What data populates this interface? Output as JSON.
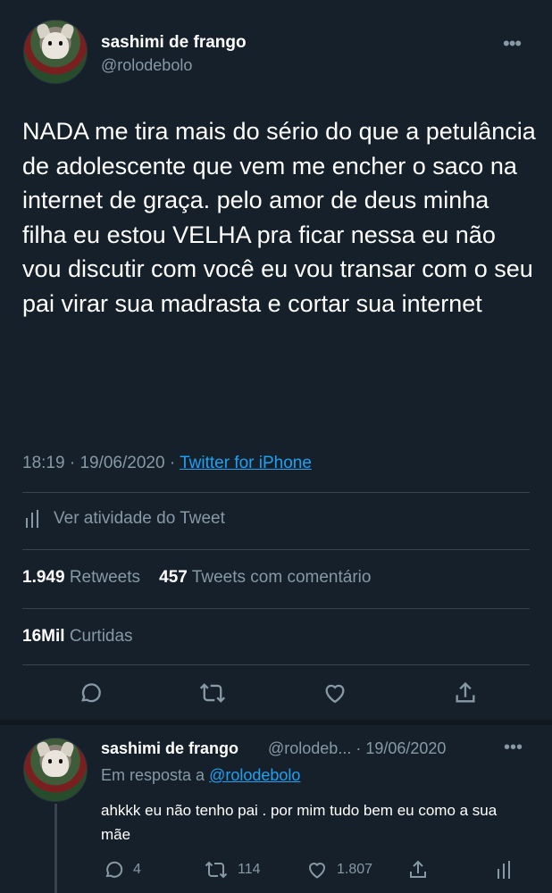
{
  "main_tweet": {
    "display_name": "sashimi de frango",
    "handle": "@rolodebolo",
    "more": "•••",
    "text": "NADA me tira mais do sério do que a petulância de adolescente que vem me encher o saco na internet de graça. pelo amor de deus minha filha eu estou VELHA pra ficar nessa eu não vou discutir com você eu vou transar com o seu pai virar sua madrasta e cortar sua internet",
    "time": "18:19",
    "date": "19/06/2020",
    "separator": "·",
    "source": "Twitter for iPhone",
    "activity_label": "Ver atividade do Tweet",
    "retweets_count": "1.949",
    "retweets_label": "Retweets",
    "comments_count": "457",
    "comments_label": "Tweets com comentário",
    "likes_count": "16Mil",
    "likes_label": "Curtidas",
    "actions": [
      "reply-icon",
      "retweet-icon",
      "like-icon",
      "share-icon"
    ]
  },
  "reply_tweet": {
    "display_name": "sashimi de frango",
    "handle_time": "@rolodeb...  · 19/06/2020",
    "more": "•••",
    "reply_prefix": "Em resposta a",
    "reply_mention": "@rolodebolo",
    "text": "ahkkk eu não tenho pai . por mim tudo bem eu como a sua mãe",
    "replies": "4",
    "retweets": "114",
    "likes": "1.807"
  },
  "colors": {
    "background": "#15202b",
    "text": "#ffffff",
    "secondary": "#8899a6",
    "accent": "#1da1f2",
    "divider": "#38444d"
  }
}
